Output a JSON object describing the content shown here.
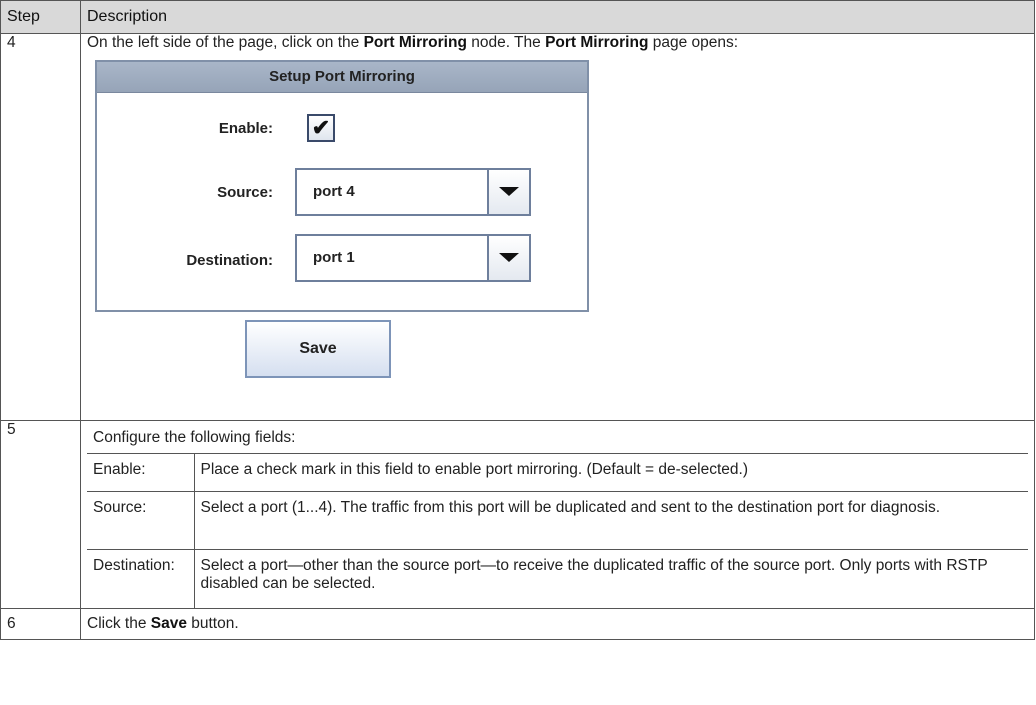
{
  "header": {
    "step": "Step",
    "description": "Description"
  },
  "step4": {
    "number": "4",
    "text_pre": "On the left side of the page, click on the ",
    "bold1": "Port Mirroring",
    "text_mid": " node. The ",
    "bold2": "Port Mirroring",
    "text_post": " page opens:",
    "panel": {
      "title": "Setup Port Mirroring",
      "enable_label": "Enable:",
      "enable_checked": true,
      "checkmark": "✔",
      "source_label": "Source:",
      "source_value": "port 4",
      "destination_label": "Destination:",
      "destination_value": "port 1",
      "save_label": "Save"
    }
  },
  "step5": {
    "number": "5",
    "intro": "Configure the following fields:",
    "fields": [
      {
        "name": "Enable:",
        "desc": "Place a check mark in this field to enable port mirroring. (Default = de-selected.)"
      },
      {
        "name": "Source:",
        "desc": "Select a port (1...4). The traffic from this port will be duplicated and sent to the destination port for diagnosis."
      },
      {
        "name": "Destination:",
        "desc": "Select a port—other than the source port—to receive the duplicated traffic of the source port. Only ports with RSTP disabled can be selected."
      }
    ]
  },
  "step6": {
    "number": "6",
    "text_pre": "Click the ",
    "bold": "Save",
    "text_post": " button."
  }
}
